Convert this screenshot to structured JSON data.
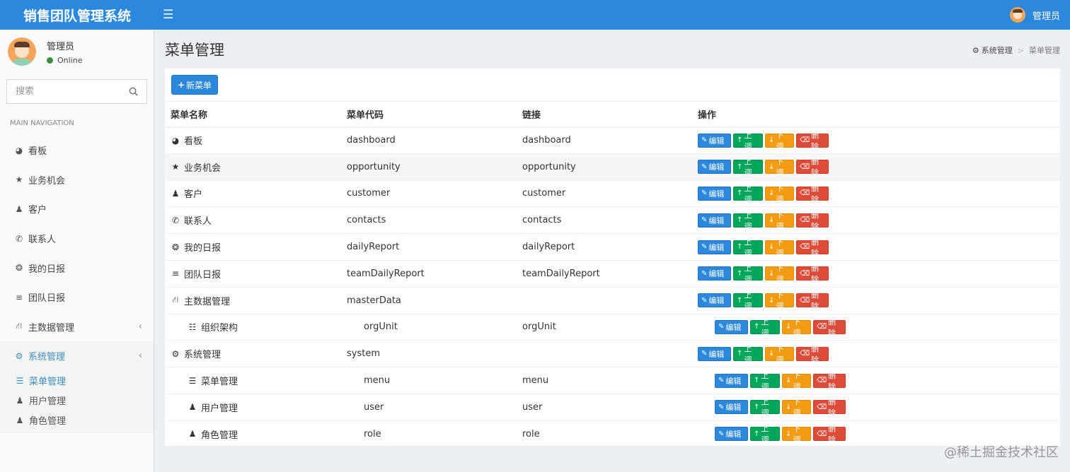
{
  "header": {
    "app_title": "销售团队管理系统",
    "toggle_icon": "hamburger-icon",
    "user_name": "管理员"
  },
  "sidebar": {
    "user_name": "管理员",
    "user_status": "Online",
    "search_placeholder": "搜索",
    "nav_header": "MAIN NAVIGATION",
    "items": [
      {
        "label": "看板",
        "icon": "dashboard-icon"
      },
      {
        "label": "业务机会",
        "icon": "star-icon"
      },
      {
        "label": "客户",
        "icon": "user-tie-icon"
      },
      {
        "label": "联系人",
        "icon": "phone-icon"
      },
      {
        "label": "我的日报",
        "icon": "pin-icon"
      },
      {
        "label": "团队日报",
        "icon": "list-ol-icon"
      },
      {
        "label": "主数据管理",
        "icon": "database-icon"
      },
      {
        "label": "系统管理",
        "icon": "gears-icon"
      }
    ],
    "sub_items": [
      {
        "label": "菜单管理",
        "icon": "list-icon"
      },
      {
        "label": "用户管理",
        "icon": "user-icon"
      },
      {
        "label": "角色管理",
        "icon": "users-icon"
      }
    ]
  },
  "content": {
    "page_title": "菜单管理",
    "breadcrumb": {
      "root": "系统管理",
      "current": "菜单管理"
    },
    "new_button": "新菜单",
    "columns": [
      "菜单名称",
      "菜单代码",
      "链接",
      "操作"
    ],
    "actions": {
      "edit": "编辑",
      "up": "上调",
      "down": "下调",
      "delete": "删除"
    },
    "rows": [
      {
        "name": "看板",
        "code": "dashboard",
        "link": "dashboard"
      },
      {
        "name": "业务机会",
        "code": "opportunity",
        "link": "opportunity"
      },
      {
        "name": "客户",
        "code": "customer",
        "link": "customer"
      },
      {
        "name": "联系人",
        "code": "contacts",
        "link": "contacts"
      },
      {
        "name": "我的日报",
        "code": "dailyReport",
        "link": "dailyReport"
      },
      {
        "name": "团队日报",
        "code": "teamDailyReport",
        "link": "teamDailyReport"
      },
      {
        "name": "主数据管理",
        "code": "masterData",
        "link": ""
      },
      {
        "name": "组织架构",
        "code": "orgUnit",
        "link": "orgUnit"
      },
      {
        "name": "系统管理",
        "code": "system",
        "link": ""
      },
      {
        "name": "菜单管理",
        "code": "menu",
        "link": "menu"
      },
      {
        "name": "用户管理",
        "code": "user",
        "link": "user"
      },
      {
        "name": "角色管理",
        "code": "role",
        "link": "role"
      }
    ]
  },
  "watermark": "@稀土掘金技术社区"
}
